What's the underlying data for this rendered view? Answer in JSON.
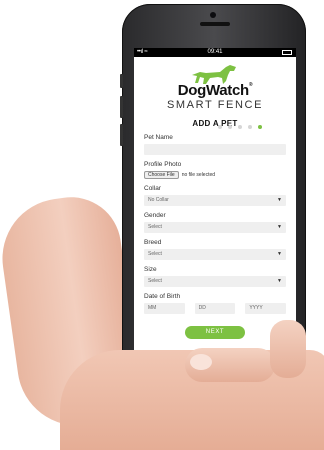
{
  "status_bar": {
    "signal": "••ıl ≈",
    "time": "09:41"
  },
  "brand": {
    "name": "DogWatch",
    "mark": "®",
    "tagline": "SMART FENCE",
    "accent_color": "#7dc142"
  },
  "page": {
    "title": "ADD A PET",
    "steps_total": 5,
    "active_step": 5
  },
  "form": {
    "pet_name": {
      "label": "Pet Name",
      "value": ""
    },
    "profile_photo": {
      "label": "Profile Photo",
      "button": "Choose File",
      "status": "no file selected"
    },
    "collar": {
      "label": "Collar",
      "value": "No Collar"
    },
    "gender": {
      "label": "Gender",
      "value": "Select"
    },
    "breed": {
      "label": "Breed",
      "value": "Select"
    },
    "size": {
      "label": "Size",
      "value": "Select"
    },
    "dob": {
      "label": "Date of Birth",
      "mm": "MM",
      "dd": "DD",
      "yyyy": "YYYY"
    }
  },
  "next_button": "NEXT",
  "icons": [
    "dog-logo-icon",
    "chevron-down-icon",
    "battery-icon",
    "signal-icon"
  ]
}
